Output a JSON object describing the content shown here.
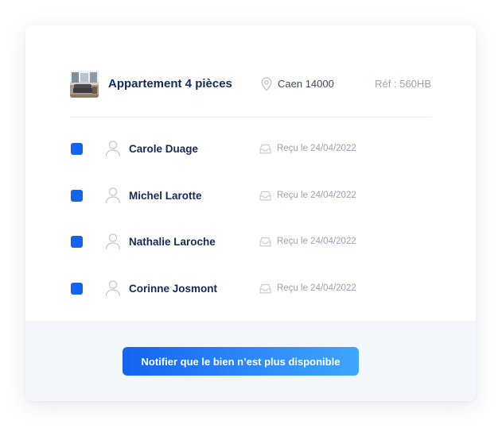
{
  "property": {
    "thumbnail_icon": "apartment-photo",
    "title": "Appartement 4 pièces",
    "location_icon": "map-pin-icon",
    "location": "Caen 14000",
    "reference": "Réf : 560HB"
  },
  "applicants": [
    {
      "name": "Carole Duage",
      "received": "Reçu le 24/04/2022",
      "checked": true
    },
    {
      "name": "Michel Larotte",
      "received": "Reçu le 24/04/2022",
      "checked": true
    },
    {
      "name": "Nathalie Laroche",
      "received": "Reçu le 24/04/2022",
      "checked": true
    },
    {
      "name": "Corinne Josmont",
      "received": "Reçu le 24/04/2022",
      "checked": true
    }
  ],
  "icons": {
    "checkbox": "checkbox-checked",
    "user": "user-icon",
    "received": "inbox-icon"
  },
  "footer": {
    "notify_label": "Notifier que le bien n’est plus disponible"
  },
  "colors": {
    "primary": "#1163f0",
    "title": "#142a5c",
    "muted": "#9aa3b5",
    "footer_bg": "#f3f6fb"
  }
}
